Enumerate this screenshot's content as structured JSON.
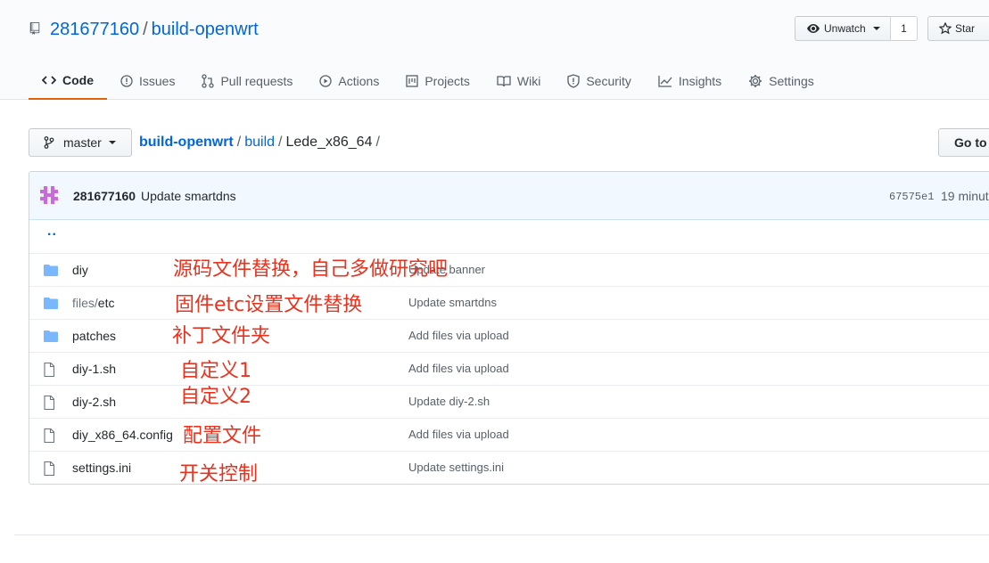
{
  "repo": {
    "owner": "281677160",
    "separator": "/",
    "name": "build-openwrt"
  },
  "actions": {
    "watch_label": "Unwatch",
    "watch_count": "1",
    "star_label": "Star"
  },
  "tabs": [
    {
      "label": "Code",
      "icon": "code-icon"
    },
    {
      "label": "Issues",
      "icon": "issue-icon"
    },
    {
      "label": "Pull requests",
      "icon": "pull-request-icon"
    },
    {
      "label": "Actions",
      "icon": "play-icon"
    },
    {
      "label": "Projects",
      "icon": "project-icon"
    },
    {
      "label": "Wiki",
      "icon": "book-icon"
    },
    {
      "label": "Security",
      "icon": "shield-icon"
    },
    {
      "label": "Insights",
      "icon": "graph-icon"
    },
    {
      "label": "Settings",
      "icon": "gear-icon"
    }
  ],
  "branch": {
    "label": "master"
  },
  "breadcrumb": {
    "root": "build-openwrt",
    "sep": "/",
    "dir1": "build",
    "current": "Lede_x86_64",
    "trail": "/"
  },
  "goto_label": "Go to",
  "commit": {
    "author": "281677160",
    "message": "Update smartdns",
    "sha": "67575e1",
    "time": "19 minut"
  },
  "updir": "..",
  "files": [
    {
      "type": "dir",
      "name": "diy",
      "name_muted": "",
      "message": "Update banner"
    },
    {
      "type": "dir",
      "name": "etc",
      "name_muted": "files/",
      "message": "Update smartdns"
    },
    {
      "type": "dir",
      "name": "patches",
      "name_muted": "",
      "message": "Add files via upload"
    },
    {
      "type": "file",
      "name": "diy-1.sh",
      "name_muted": "",
      "message": "Add files via upload"
    },
    {
      "type": "file",
      "name": "diy-2.sh",
      "name_muted": "",
      "message": "Update diy-2.sh"
    },
    {
      "type": "file",
      "name": "diy_x86_64.config",
      "name_muted": "",
      "message": "Add files via upload"
    },
    {
      "type": "file",
      "name": "settings.ini",
      "name_muted": "",
      "message": "Update settings.ini"
    }
  ],
  "annotations": [
    "源码文件替换，自己多做研究吧",
    "固件etc设置文件替换",
    "补丁文件夹",
    "自定义1",
    "自定义2",
    "配置文件",
    "开关控制"
  ],
  "colors": {
    "link": "#0366d6",
    "annotation": "#e8331f",
    "tab_underline": "#e36209",
    "folder": "#79b8ff",
    "commit_bar": "#f1f8ff"
  }
}
